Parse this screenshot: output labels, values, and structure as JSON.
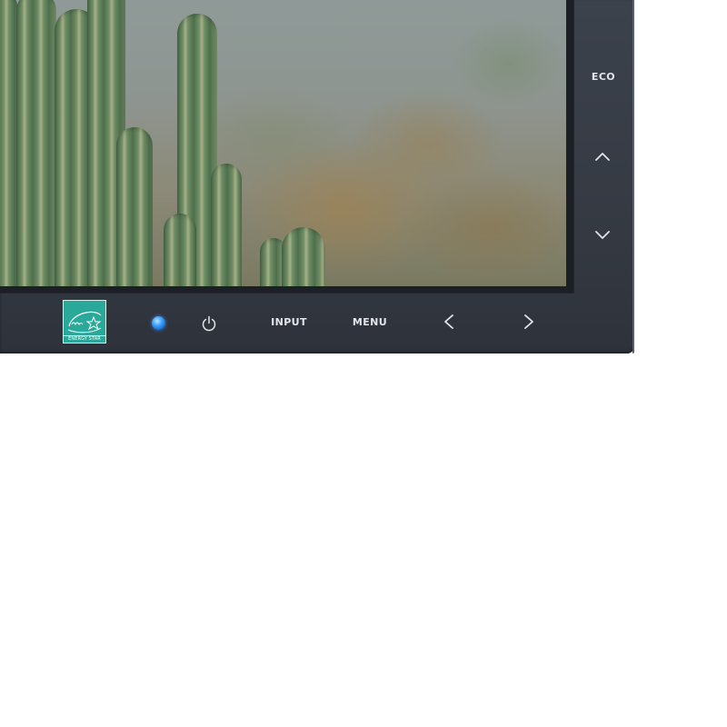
{
  "monitor": {
    "eco_label": "ECO",
    "input_label": "INPUT",
    "menu_label": "MENU",
    "energy_star_label": "ENERGY STAR",
    "energy_star_script": "energy",
    "icons": {
      "power": "power-icon",
      "up": "chevron-up-icon",
      "down": "chevron-down-icon",
      "left": "chevron-left-icon",
      "right": "chevron-right-icon",
      "led": "power-led-indicator"
    },
    "colors": {
      "bezel": "#363b44",
      "button_text": "#e2e5ea",
      "led": "#3aa0ff",
      "energy_star": "#2aa89a"
    }
  }
}
